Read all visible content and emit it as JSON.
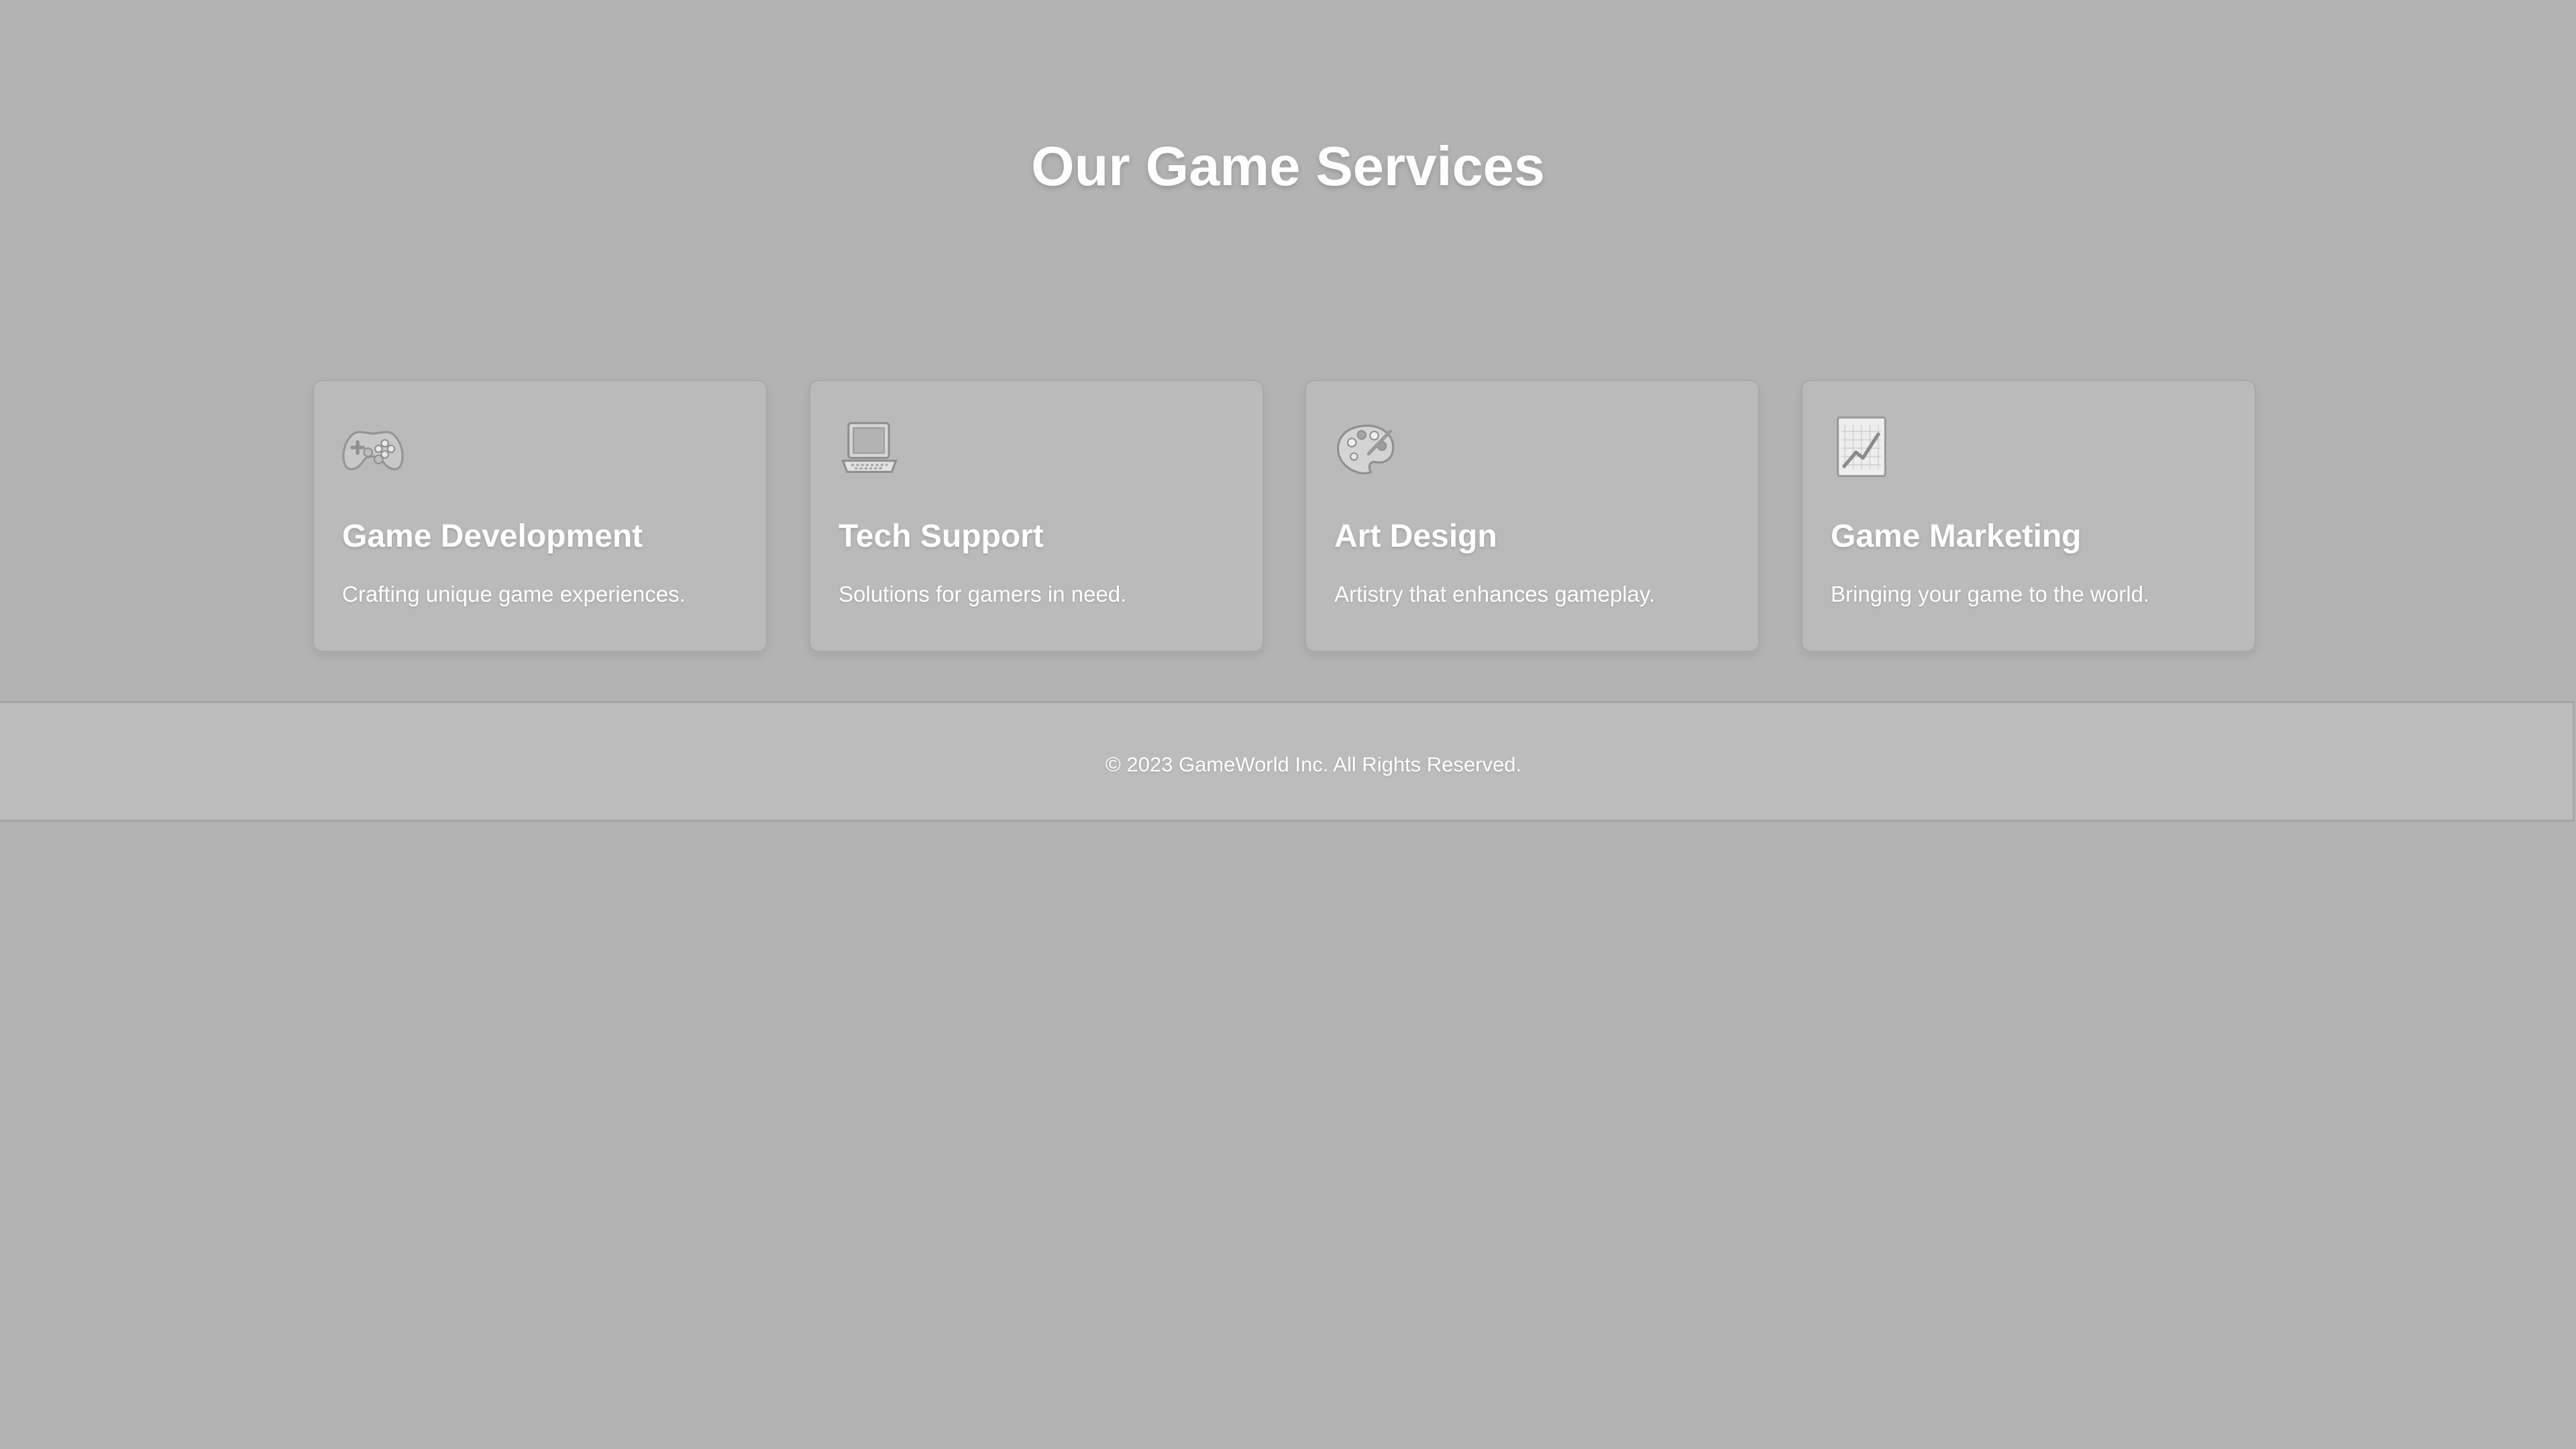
{
  "page": {
    "title": "Our Game Services"
  },
  "services": [
    {
      "icon": "game-controller-icon",
      "title": "Game Development",
      "description": "Crafting unique game experiences."
    },
    {
      "icon": "laptop-icon",
      "title": "Tech Support",
      "description": "Solutions for gamers in need."
    },
    {
      "icon": "artist-palette-icon",
      "title": "Art Design",
      "description": "Artistry that enhances gameplay."
    },
    {
      "icon": "chart-increasing-icon",
      "title": "Game Marketing",
      "description": "Bringing your game to the world."
    }
  ],
  "footer": {
    "copyright": "© 2023 GameWorld Inc. All Rights Reserved."
  },
  "colors": {
    "background": "#b3b3b3",
    "card": "#bababa",
    "footer": "#bcbcbc",
    "text": "#ffffff"
  }
}
